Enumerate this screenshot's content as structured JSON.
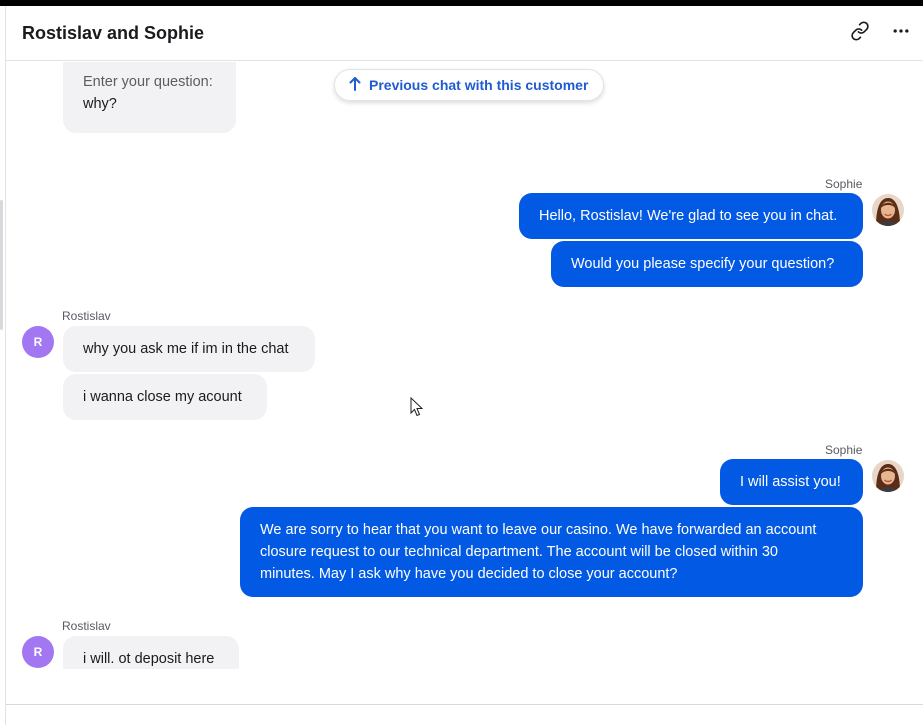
{
  "header": {
    "title": "Rostislav and Sophie",
    "link_icon": "link-icon",
    "more_icon": "more-horizontal-icon"
  },
  "chat": {
    "previous_chat_label": "Previous chat with this customer",
    "previous_chat_icon": "arrow-up-icon",
    "messages": [
      {
        "from": "Rostislav",
        "lines": [
          "Enter your question:",
          "why?"
        ]
      },
      {
        "from": "Sophie",
        "sender_label": "Sophie",
        "text": "Hello, Rostislav! We're glad to see you in chat."
      },
      {
        "from": "Sophie",
        "text": "Would you please specify your question?"
      },
      {
        "from": "Rostislav",
        "sender_label": "Rostislav",
        "avatar_initial": "R",
        "text": "why you ask me if im in the chat"
      },
      {
        "from": "Rostislav",
        "text": "i wanna close my acount"
      },
      {
        "from": "Sophie",
        "sender_label": "Sophie",
        "text": "I will assist you!"
      },
      {
        "from": "Sophie",
        "lines": [
          "We are sorry to hear that you want to leave our casino. We have forwarded an account",
          "closure request to our technical department. The account will be closed within 30",
          "minutes. May I ask why have you decided to close your account?"
        ]
      },
      {
        "from": "Rostislav",
        "sender_label": "Rostislav",
        "avatar_initial": "R",
        "text": "i will. ot deposit here"
      }
    ]
  },
  "colors": {
    "agent_bubble": "#0259e4",
    "customer_bubble": "#f2f2f4",
    "customer_avatar": "#a377f2",
    "link_accent": "#1f5bd1"
  }
}
